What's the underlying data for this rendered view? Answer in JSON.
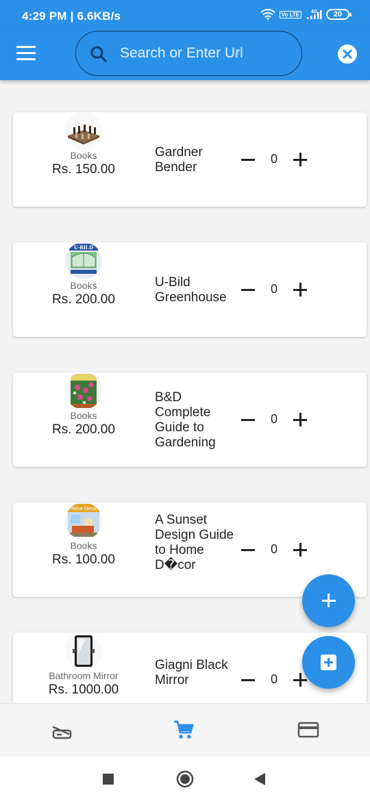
{
  "status_bar": {
    "time_and_speed": "4:29 PM | 6.6KB/s",
    "volte": "Vo LTE",
    "network": "4G",
    "battery": "20"
  },
  "app_bar": {
    "search_placeholder": "Search or Enter Url",
    "search_value": ""
  },
  "products": [
    {
      "category": "Books",
      "price": "Rs. 150.00",
      "name": "Gardner Bender",
      "quantity": "0",
      "thumb_icon": "chess-board-thumbnail"
    },
    {
      "category": "Books",
      "price": "Rs. 200.00",
      "name": "U-Bild Greenhouse",
      "quantity": "0",
      "thumb_icon": "greenhouse-book-thumbnail",
      "thumb_text": "U-BILD"
    },
    {
      "category": "Books",
      "price": "Rs. 200.00",
      "name": "B&D Complete Guide to Gardening",
      "quantity": "0",
      "thumb_icon": "gardening-book-thumbnail"
    },
    {
      "category": "Books",
      "price": "Rs. 100.00",
      "name": "A Sunset Design Guide to Home D�cor",
      "quantity": "0",
      "thumb_icon": "home-decor-book-thumbnail",
      "thumb_text": "Home Decor"
    },
    {
      "category": "Bathroom Mirror",
      "price": "Rs. 1000.00",
      "name": "Giagni Black Mirror",
      "quantity": "0",
      "thumb_icon": "mirror-thumbnail"
    }
  ],
  "bottom_nav": {
    "items": [
      "scanner-icon",
      "cart-icon",
      "credit-card-icon"
    ],
    "active": "cart-icon"
  },
  "colors": {
    "primary": "#2b90e8",
    "background": "#f3f3f3"
  }
}
